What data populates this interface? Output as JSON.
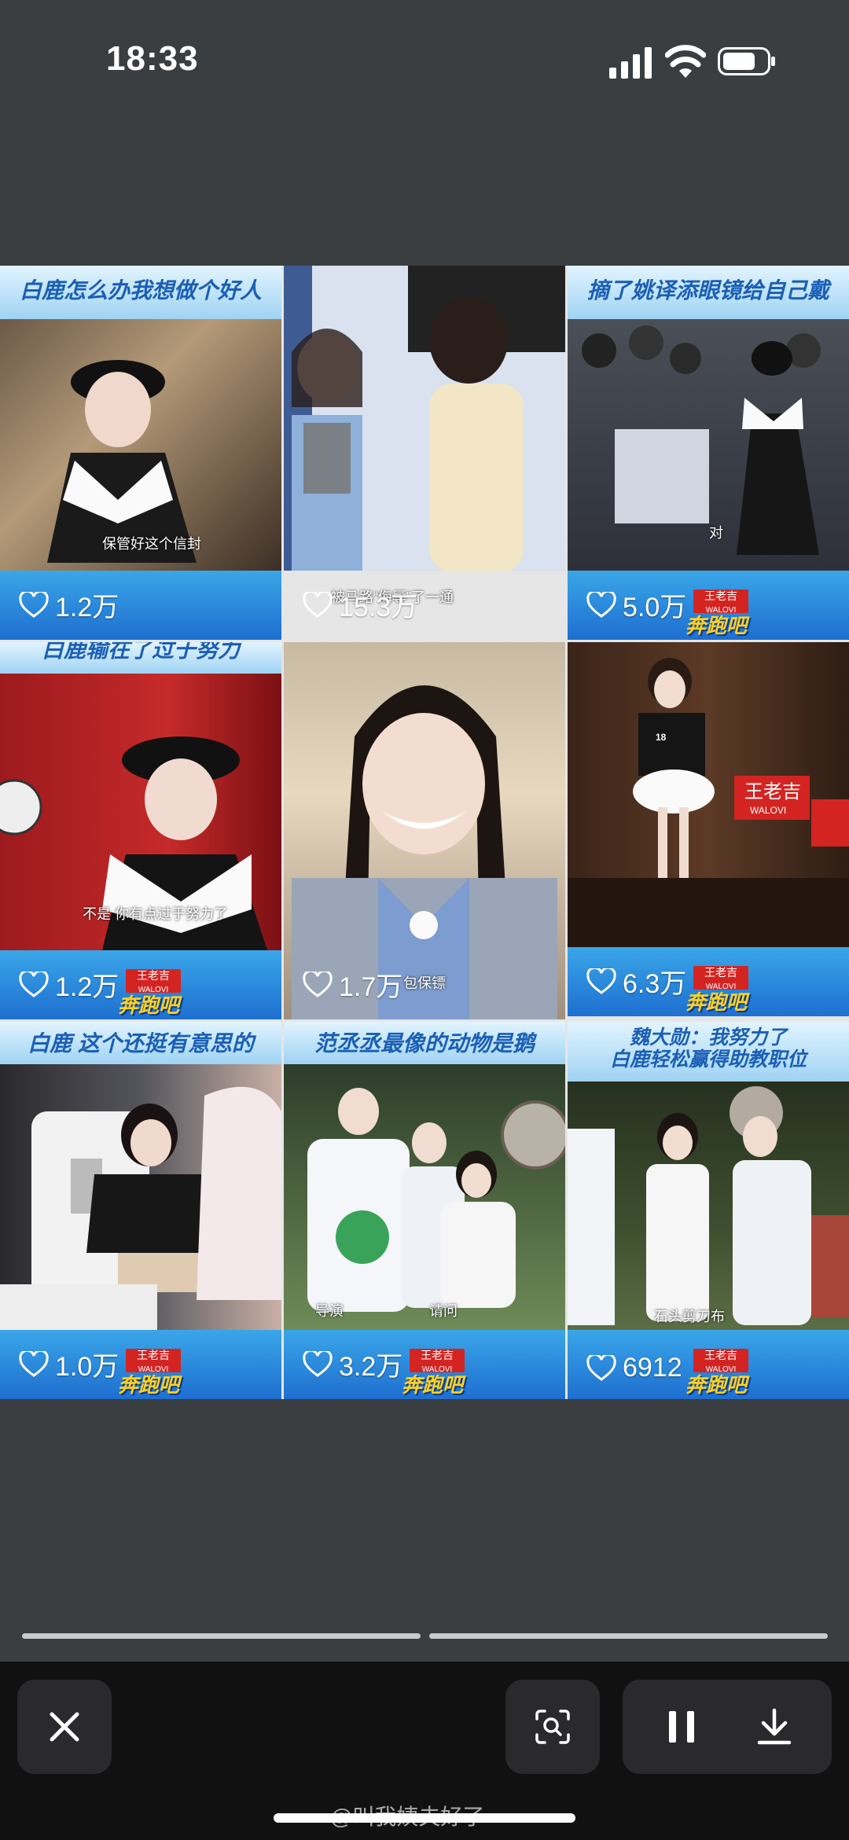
{
  "status_bar": {
    "time": "18:33"
  },
  "tiles": [
    {
      "caption": "白鹿怎么办我想做个好人",
      "subtitle": "保管好这个信封",
      "likes": "1.2万",
      "has_logo": false
    },
    {
      "caption": "",
      "subtitle": "被马路“侮辱”了一通",
      "likes": "15.3万",
      "has_logo": false
    },
    {
      "caption": "摘了姚译添眼镜给自己戴",
      "subtitle": "对",
      "likes": "5.0万",
      "has_logo": true
    },
    {
      "caption": "白鹿输在了过于努力",
      "subtitle": "不是 你有点过于努力了",
      "likes": "1.2万",
      "has_logo": true
    },
    {
      "caption": "",
      "subtitle": "包保镖",
      "likes": "1.7万",
      "has_logo": false
    },
    {
      "caption": "",
      "subtitle": "",
      "likes": "6.3万",
      "has_logo": true
    },
    {
      "caption": "白鹿 这个还挺有意思的",
      "subtitle": "",
      "likes": "1.0万",
      "has_logo": true
    },
    {
      "caption": "范丞丞最像的动物是鹅",
      "subtitle": "导演",
      "subtitle2": "请问",
      "likes": "3.2万",
      "has_logo": true
    },
    {
      "caption": "魏大勋：我努力了\n白鹿轻松赢得助教职位",
      "subtitle": "石头剪刀布",
      "likes": "6912",
      "has_logo": true
    }
  ],
  "logo": {
    "brand": "王老吉",
    "brand_en": "WALOVI",
    "show": "奔跑吧"
  },
  "scene_signs": {
    "sign1": "王老吉",
    "sign1_en": "WALOVI",
    "jersey": "18"
  },
  "watermark": "@叫我姨夫好了",
  "icons": {
    "close": "close-icon",
    "scan": "lens-scan-icon",
    "pause": "pause-icon",
    "download": "download-icon"
  },
  "colors": {
    "background": "#3a3e41",
    "caption_text": "#1b5fb5",
    "banner": "#1e6fd0",
    "bottom_bar": "#111111"
  }
}
